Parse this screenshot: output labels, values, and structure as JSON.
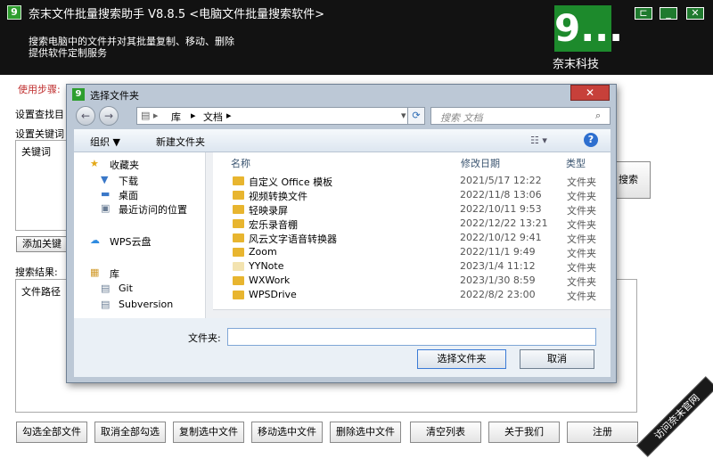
{
  "header": {
    "app_icon": "9",
    "title": "奈末文件批量搜索助手  V8.8.5   <电脑文件批量搜索软件>",
    "desc_line1": "搜索电脑中的文件并对其批量复制、移动、删除",
    "desc_line2": "提供软件定制服务",
    "brand_logo": "9...",
    "brand_name": "奈末科技",
    "restore_icon": "restore-icon",
    "minimize_icon": "minimize-icon",
    "close_icon": "close-icon"
  },
  "main": {
    "steps_label": "使用步骤:",
    "set_dir_label": "设置查找目",
    "set_keyword_label": "设置关键词",
    "keyword_col": "关键词",
    "add_keyword_btn": "添加关键",
    "search_btn": "搜索",
    "result_label": "搜索结果:",
    "file_path_col": "文件路径"
  },
  "bottom_buttons": [
    "勾选全部文件",
    "取消全部勾选",
    "复制选中文件",
    "移动选中文件",
    "删除选中文件",
    "清空列表",
    "关于我们",
    "注册"
  ],
  "badge": "访问奈末官网",
  "dialog": {
    "title": "选择文件夹",
    "breadcrumb": [
      "库",
      "文档"
    ],
    "search_placeholder": "搜索 文档",
    "toolbar": {
      "organize": "组织 ▼",
      "new_folder": "新建文件夹"
    },
    "nav": [
      "收藏夹",
      "下载",
      "桌面",
      "最近访问的位置",
      "WPS云盘",
      "库",
      "Git",
      "Subversion"
    ],
    "columns": {
      "name": "名称",
      "date": "修改日期",
      "type": "类型"
    },
    "rows": [
      {
        "name": "自定义 Office 模板",
        "date": "2021/5/17 12:22",
        "type": "文件夹"
      },
      {
        "name": "视频转换文件",
        "date": "2022/11/8 13:06",
        "type": "文件夹"
      },
      {
        "name": "轻映录屏",
        "date": "2022/10/11 9:53",
        "type": "文件夹"
      },
      {
        "name": "宏乐录音棚",
        "date": "2022/12/22 13:21",
        "type": "文件夹"
      },
      {
        "name": "风云文字语音转换器",
        "date": "2022/10/12 9:41",
        "type": "文件夹"
      },
      {
        "name": "Zoom",
        "date": "2022/11/1 9:49",
        "type": "文件夹"
      },
      {
        "name": "YYNote",
        "date": "2023/1/4 11:12",
        "type": "文件夹"
      },
      {
        "name": "WXWork",
        "date": "2023/1/30 8:59",
        "type": "文件夹"
      },
      {
        "name": "WPSDrive",
        "date": "2022/8/2 23:00",
        "type": "文件夹"
      }
    ],
    "folder_label": "文件夹:",
    "folder_value": "",
    "select_btn": "选择文件夹",
    "cancel_btn": "取消"
  }
}
